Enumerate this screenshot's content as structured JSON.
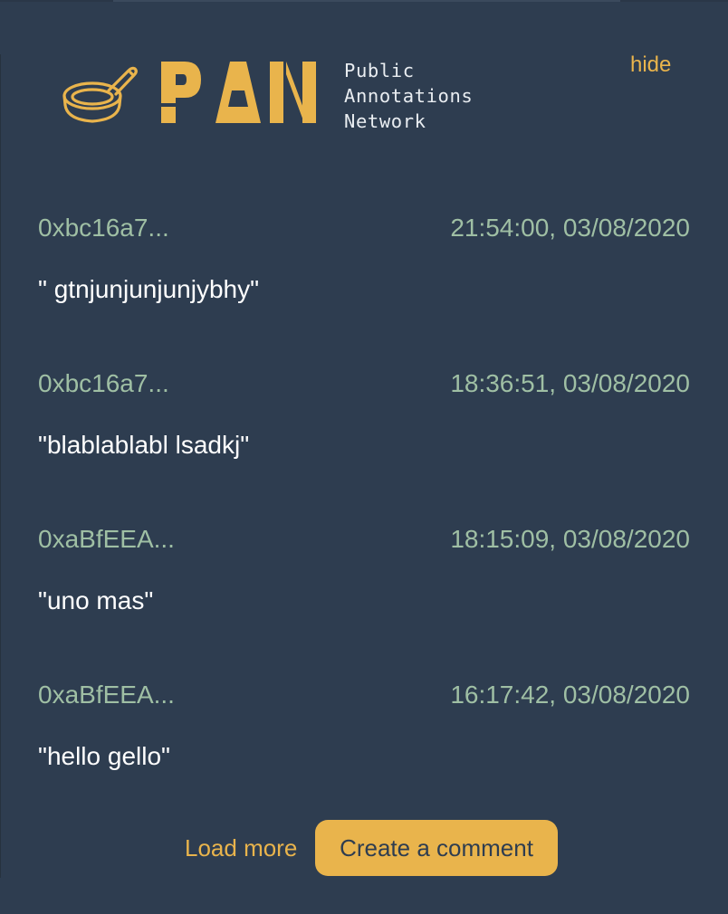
{
  "colors": {
    "background": "#2e3d50",
    "accent": "#e9b44c",
    "author_time": "#9fbfa4",
    "text": "#ffffff"
  },
  "header": {
    "logo_icon": "frying-pan-icon",
    "logo_word": "PAN",
    "tagline": [
      "Public",
      "Annotations",
      "Network"
    ],
    "hide_label": "hide"
  },
  "comments": [
    {
      "author": "0xbc16a7...",
      "time": "21:54:00, 03/08/2020",
      "text": "\" gtnjunjunjunjybhy\""
    },
    {
      "author": "0xbc16a7...",
      "time": "18:36:51, 03/08/2020",
      "text": "\"blablablabl lsadkj\""
    },
    {
      "author": "0xaBfEEA...",
      "time": "18:15:09, 03/08/2020",
      "text": "\"uno mas\""
    },
    {
      "author": "0xaBfEEA...",
      "time": "16:17:42, 03/08/2020",
      "text": "\"hello gello\""
    }
  ],
  "actions": {
    "load_more": "Load more",
    "create_comment": "Create a comment"
  }
}
